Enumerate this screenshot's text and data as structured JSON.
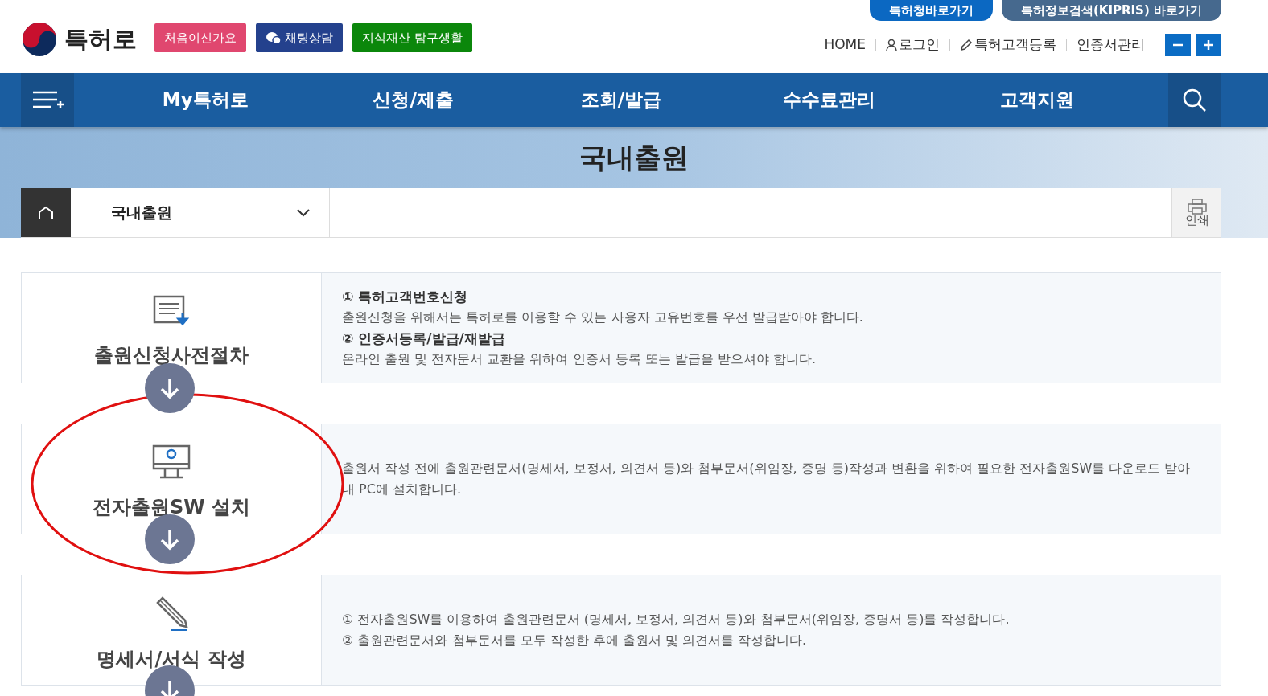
{
  "header": {
    "logo": "특허로",
    "quick_buttons": [
      {
        "label": "처음이신가요",
        "color": "#e0476f",
        "kind": "plain"
      },
      {
        "label": "채팅상담",
        "color": "#24418d",
        "kind": "chat"
      },
      {
        "label": "지식재산 탐구생활",
        "color": "#0b870b",
        "kind": "plain"
      }
    ],
    "top_pills": [
      {
        "label": "특허청바로가기",
        "color": "#0b68c2"
      },
      {
        "label": "특허정보검색(KIPRIS) 바로가기",
        "color": "#46698e"
      }
    ],
    "util_links": [
      {
        "label": "HOME",
        "kind": "plain"
      },
      {
        "label": "로그인",
        "kind": "person"
      },
      {
        "label": "특허고객등록",
        "kind": "pencil"
      },
      {
        "label": "인증서관리",
        "kind": "plain"
      }
    ],
    "zoom_buttons": [
      {
        "kind": "minus"
      },
      {
        "kind": "plus"
      }
    ]
  },
  "nav": {
    "items": [
      "My특허로",
      "신청/제출",
      "조회/발급",
      "수수료관리",
      "고객지원"
    ]
  },
  "page_title": "국내출원",
  "breadcrumb": {
    "dropdown": "국내출원",
    "print": "인쇄"
  },
  "steps": [
    {
      "title": "출원신청사전절차",
      "kind": "document",
      "lines": [
        {
          "kind": "heading",
          "text": "① 특허고객번호신청"
        },
        {
          "kind": "text",
          "text": "출원신청을 위해서는 특허로를 이용할 수 있는 사용자 고유번호를 우선 발급받아야 합니다."
        },
        {
          "kind": "heading",
          "text": "② 인증서등록/발급/재발급"
        },
        {
          "kind": "text",
          "text": "온라인 출원 및 전자문서 교환을 위하여 인증서 등록 또는 발급을 받으셔야 합니다."
        }
      ]
    },
    {
      "title": "전자출원SW 설치",
      "kind": "monitor",
      "lines": [
        {
          "kind": "text",
          "text": "출원서 작성 전에 출원관련문서(명세서, 보정서, 의견서 등)와 첨부문서(위임장, 증명 등)작성과 변환을 위하여 필요한 전자출원SW를 다운로드 받아 내 PC에 설치합니다."
        }
      ]
    },
    {
      "title": "명세서/서식 작성",
      "kind": "pencil",
      "lines": [
        {
          "kind": "text",
          "text": "① 전자출원SW를 이용하여 출원관련문서 (명세서, 보정서, 의견서 등)와 첨부문서(위임장, 증명서 등)를 작성합니다."
        },
        {
          "kind": "text",
          "text": "② 출원관련문서와 첨부문서를 모두 작성한 후에 출원서 및 의견서를 작성합니다."
        }
      ]
    }
  ]
}
